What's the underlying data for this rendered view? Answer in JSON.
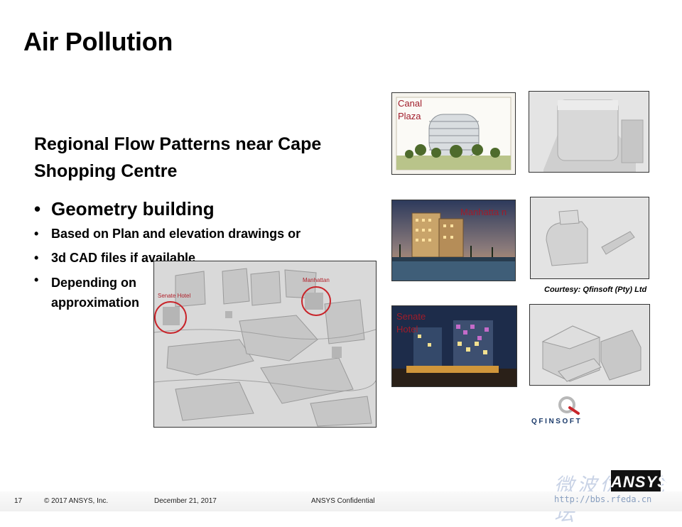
{
  "slide": {
    "title": "Air Pollution",
    "subtitle": "Regional Flow Patterns near Cape Shopping Centre",
    "bullets": [
      "Geometry building",
      "Based on Plan and elevation drawings or",
      "3d CAD files if available",
      "Depending on",
      "approximation"
    ]
  },
  "images": {
    "canal_label": "Canal Plaza",
    "manhattan_label": "Manhatta n",
    "senate_label": "Senate Hotel",
    "map_senate": "Senate Hotel",
    "map_manhattan": "Manhattan",
    "courtesy": "Courtesy: Qfinsoft (Pty) Ltd",
    "logo": "QFINSOFT"
  },
  "footer": {
    "page": "17",
    "copyright": "© 2017 ANSYS, Inc.",
    "date": "December 21, 2017",
    "confidential": "ANSYS Confidential",
    "brand": "ANSYS",
    "watermark_url": "http://bbs.rfeda.cn"
  },
  "colors": {
    "label_red": "#a01c2a",
    "brand_black": "#111111"
  }
}
